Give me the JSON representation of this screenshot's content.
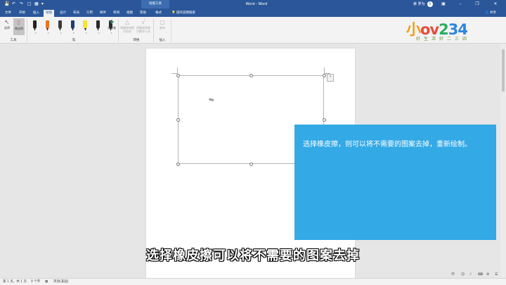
{
  "titlebar": {
    "context_tab": "绘图工具",
    "document_title": "Word - Word",
    "user_name": "姜 罗为",
    "avatar_initial": "R"
  },
  "tabs": [
    "文件",
    "开始",
    "插入",
    "绘图",
    "设计",
    "布局",
    "引用",
    "邮件",
    "审阅",
    "视图",
    "帮助",
    "格式"
  ],
  "active_tab": "绘图",
  "tell_me": "操作说明搜索",
  "share": "共享",
  "ribbon": {
    "groups": {
      "tools": "工具",
      "pens": "笔",
      "convert": "转换",
      "insert": "插入"
    },
    "buttons": {
      "select": "选择",
      "eraser": "橡皮擦",
      "add_pen": "添加笔",
      "ink_to_shape": "将墨迹转换为形状",
      "ink_to_math": "将墨迹转换为数学公式",
      "canvas": "画布"
    },
    "pen_colors": [
      "#222222",
      "#e87722",
      "#3b3b3b",
      "#1f3d7a",
      "#f3e62f",
      "#2a2a2a",
      "#2a2a2a"
    ]
  },
  "logo": {
    "text_part1": "小",
    "text_part2": "ov",
    "text_part3": "2",
    "text_part4": "34",
    "subtitle": "好生活好二三四"
  },
  "tutorial": {
    "tip_text": "选择橡皮擦，则可以将不需要的图案去掉，重新绘制。",
    "subtitle": "选择橡皮擦可以将不需要的图案去掉"
  },
  "statusbar": {
    "page": "第 1 页，共 1 页",
    "words": "0 个字",
    "language": "英语(美国)"
  }
}
